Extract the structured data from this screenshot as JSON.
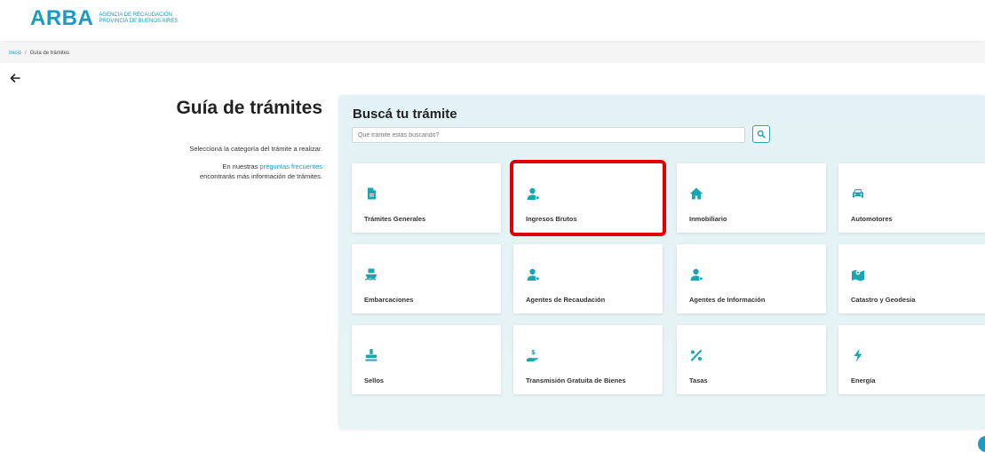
{
  "header": {
    "logo_text": "ARBA",
    "logo_sub_line1": "AGENCIA DE RECAUDACIÓN",
    "logo_sub_line2": "PROVINCIA DE BUENOS AIRES"
  },
  "breadcrumb": {
    "home": "Inicio",
    "separator": "/",
    "current": "Guía de trámites"
  },
  "left": {
    "title": "Guía de trámites",
    "intro": "Seleccioná la categoría del trámite a realizar.",
    "faq_prefix": "En nuestras ",
    "faq_link": "preguntas frecuentes",
    "faq_suffix": "encontrarás más información de trámites."
  },
  "search": {
    "title": "Buscá tu trámite",
    "placeholder": "Qué trámite estás buscando?",
    "button_icon": "search-icon"
  },
  "categories": [
    {
      "label": "Trámites Generales",
      "icon": "document-icon",
      "highlighted": false
    },
    {
      "label": "Ingresos Brutos",
      "icon": "user-tag-icon",
      "highlighted": true
    },
    {
      "label": "Inmobiliario",
      "icon": "house-icon",
      "highlighted": false
    },
    {
      "label": "Automotores",
      "icon": "car-icon",
      "highlighted": false
    },
    {
      "label": "Embarcaciones",
      "icon": "ship-icon",
      "highlighted": false
    },
    {
      "label": "Agentes de Recaudación",
      "icon": "user-tag-icon",
      "highlighted": false
    },
    {
      "label": "Agentes de Información",
      "icon": "user-tag-icon",
      "highlighted": false
    },
    {
      "label": "Catastro y Geodesia",
      "icon": "map-marker-icon",
      "highlighted": false
    },
    {
      "label": "Sellos",
      "icon": "stamp-icon",
      "highlighted": false
    },
    {
      "label": "Transmisión Gratuita de Bienes",
      "icon": "hand-money-icon",
      "highlighted": false
    },
    {
      "label": "Tasas",
      "icon": "percent-icon",
      "highlighted": false
    },
    {
      "label": "Energía",
      "icon": "bolt-icon",
      "highlighted": false
    }
  ],
  "colors": {
    "brand": "#1a9bc4",
    "icon_teal": "#1aa6b0",
    "highlight": "#e00000"
  }
}
